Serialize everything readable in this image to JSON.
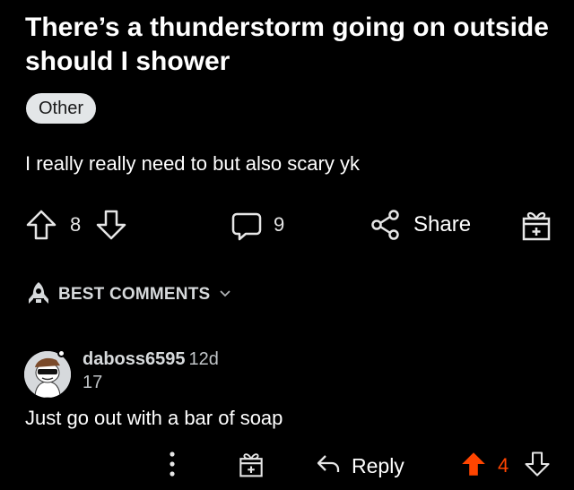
{
  "post": {
    "title": "There’s a thunderstorm going on outside should I shower",
    "flair": "Other",
    "body": "I really really need to but also scary yk",
    "vote_count": "8",
    "comment_count": "9",
    "share_label": "Share"
  },
  "sort": {
    "label": "BEST COMMENTS"
  },
  "comment": {
    "username": "daboss6595",
    "age": "12d",
    "karma": "17",
    "text": "Just go out with a bar of soap",
    "reply_label": "Reply",
    "vote_count": "4"
  },
  "colors": {
    "background": "#000000",
    "upvote_active": "#ff4500",
    "flair_bg": "#e3e6e8"
  },
  "icons": [
    "upvote-icon",
    "downvote-icon",
    "comment-icon",
    "share-icon",
    "award-icon",
    "rocket-icon",
    "chevron-down-icon",
    "more-icon",
    "reply-icon"
  ]
}
